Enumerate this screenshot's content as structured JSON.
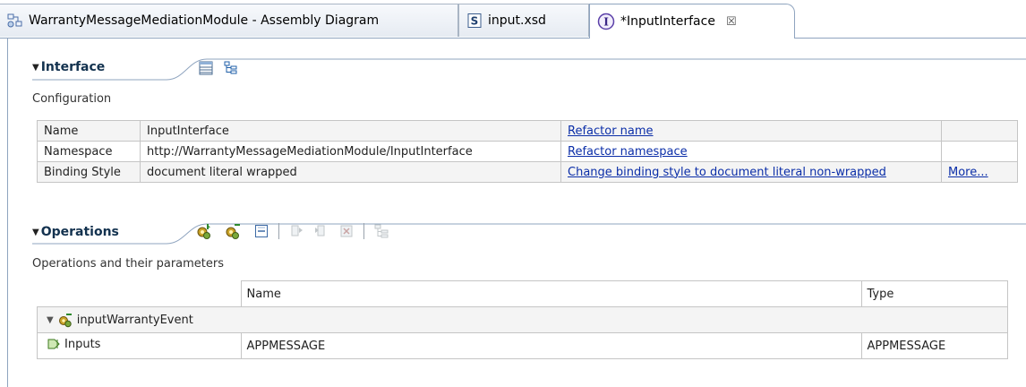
{
  "tabs": [
    {
      "label": "WarrantyMessageMediationModule - Assembly Diagram",
      "icon": "assembly-diagram-icon"
    },
    {
      "label": "input.xsd",
      "icon": "schema-s-icon"
    },
    {
      "label": "*InputInterface",
      "icon": "interface-i-icon",
      "close": "☒"
    }
  ],
  "interface": {
    "title": "Interface",
    "subtitle": "Configuration",
    "rows": [
      {
        "label": "Name",
        "value": "InputInterface",
        "action": "Refactor name",
        "extra": ""
      },
      {
        "label": "Namespace",
        "value": "http://WarrantyMessageMediationModule/InputInterface",
        "action": "Refactor namespace",
        "extra": ""
      },
      {
        "label": "Binding Style",
        "value": "document literal wrapped",
        "action": "Change binding style to document literal non-wrapped",
        "extra": "More..."
      }
    ]
  },
  "operations": {
    "title": "Operations",
    "subtitle": "Operations and their parameters",
    "columns": {
      "name": "Name",
      "type": "Type"
    },
    "operation": "inputWarrantyEvent",
    "input_row": {
      "label": "Inputs",
      "name": "APPMESSAGE",
      "type": "APPMESSAGE"
    }
  }
}
